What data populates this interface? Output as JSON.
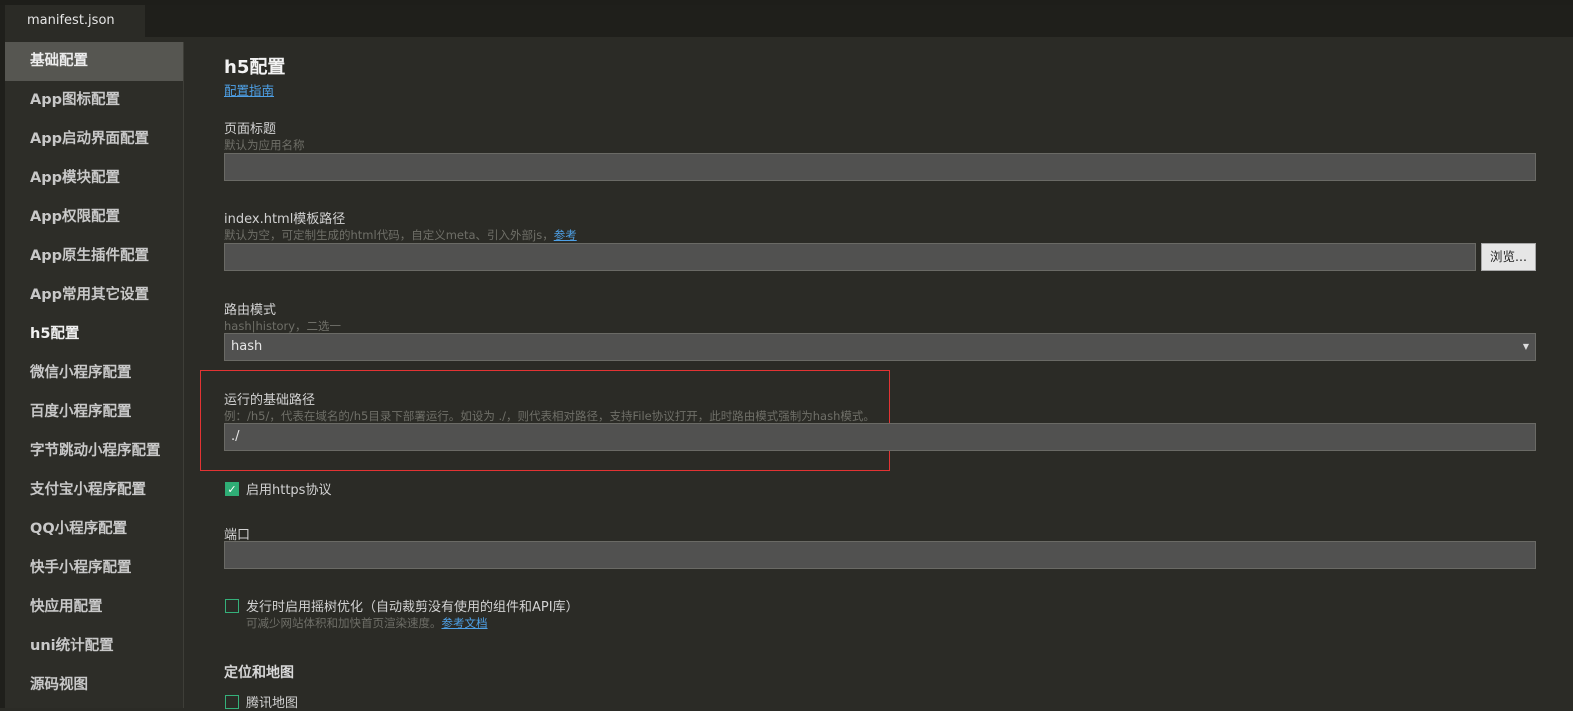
{
  "tab": {
    "label": "manifest.json"
  },
  "sidebar": {
    "items": [
      {
        "label": "基础配置"
      },
      {
        "label": "App图标配置"
      },
      {
        "label": "App启动界面配置"
      },
      {
        "label": "App模块配置"
      },
      {
        "label": "App权限配置"
      },
      {
        "label": "App原生插件配置"
      },
      {
        "label": "App常用其它设置"
      },
      {
        "label": "h5配置"
      },
      {
        "label": "微信小程序配置"
      },
      {
        "label": "百度小程序配置"
      },
      {
        "label": "字节跳动小程序配置"
      },
      {
        "label": "支付宝小程序配置"
      },
      {
        "label": "QQ小程序配置"
      },
      {
        "label": "快手小程序配置"
      },
      {
        "label": "快应用配置"
      },
      {
        "label": "uni统计配置"
      },
      {
        "label": "源码视图"
      }
    ]
  },
  "main": {
    "title": "h5配置",
    "guide_link": "配置指南",
    "page_title": {
      "label": "页面标题",
      "hint": "默认为应用名称",
      "value": ""
    },
    "template": {
      "label": "index.html模板路径",
      "hint": "默认为空，可定制生成的html代码，自定义meta、引入外部js，",
      "hint_link": "参考",
      "value": "",
      "browse_label": "浏览..."
    },
    "router": {
      "label": "路由模式",
      "hint": "hash|history，二选一",
      "value": "hash"
    },
    "base_path": {
      "label": "运行的基础路径",
      "hint": "例：/h5/，代表在域名的/h5目录下部署运行。如设为 ./，则代表相对路径，支持File协议打开，此时路由模式强制为hash模式。",
      "value": "./"
    },
    "https": {
      "label": "启用https协议",
      "checked": true
    },
    "port": {
      "label": "端口",
      "value": ""
    },
    "treeshake": {
      "label": "发行时启用摇树优化（自动裁剪没有使用的组件和API库）",
      "hint": "可减少网站体积和加快首页渲染速度。",
      "hint_link": "参考文档",
      "checked": false
    },
    "location_section": "定位和地图",
    "tencent_map": {
      "label": "腾讯地图",
      "checked": false
    }
  },
  "colors": {
    "accent_link": "#4ea0e6",
    "checkbox": "#2fae76",
    "highlight_border": "#e23333"
  }
}
